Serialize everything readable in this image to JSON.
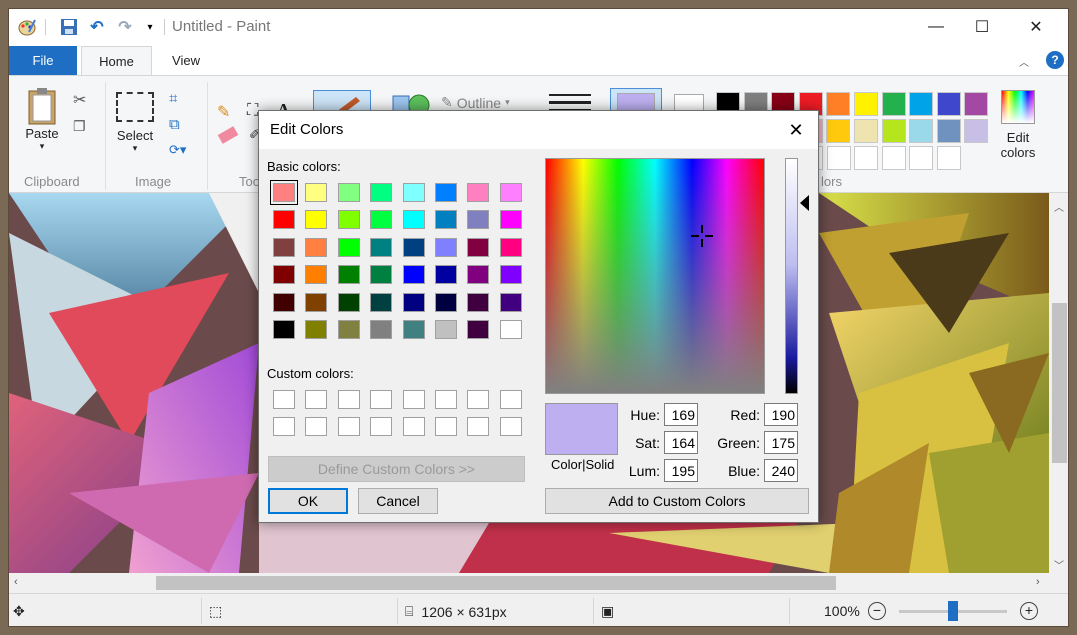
{
  "window": {
    "title": "Untitled - Paint",
    "controls": {
      "minimize": "—",
      "maximize": "☐",
      "close": "✕"
    }
  },
  "ribbon": {
    "tabs": [
      "File",
      "Home",
      "View"
    ],
    "clipboard": {
      "paste_label": "Paste",
      "group": "Clipboard"
    },
    "image": {
      "select_label": "Select",
      "group": "Image"
    },
    "tools": {
      "group": "Too"
    },
    "shapes": {
      "outline_label": "Outline"
    },
    "colors": {
      "group": "lors",
      "edit_colors_line1": "Edit",
      "edit_colors_line2": "colors"
    },
    "palette_row1": [
      "#000000",
      "#7f7f7f",
      "#880015",
      "#ed1c24",
      "#ff7f27",
      "#fff200",
      "#22b14c",
      "#00a2e8",
      "#3f48cc",
      "#a349a4"
    ],
    "palette_row2": [
      "#ffffff",
      "#c3c3c3",
      "#b97a57",
      "#ffaec9",
      "#ffc90e",
      "#efe4b0",
      "#b5e61d",
      "#99d9ea",
      "#7092be",
      "#c8bfe7"
    ],
    "color1": "#bdaff0",
    "color2": "#ffffff"
  },
  "dialog": {
    "title": "Edit Colors",
    "basic_colors_label": "Basic colors:",
    "custom_colors_label": "Custom colors:",
    "basic_colors": [
      [
        "#ff8080",
        "#ffff80",
        "#80ff80",
        "#00ff80",
        "#80ffff",
        "#0080ff",
        "#ff80c0",
        "#ff80ff"
      ],
      [
        "#ff0000",
        "#ffff00",
        "#80ff00",
        "#00ff40",
        "#00ffff",
        "#0080c0",
        "#8080c0",
        "#ff00ff"
      ],
      [
        "#804040",
        "#ff8040",
        "#00ff00",
        "#008080",
        "#004080",
        "#8080ff",
        "#800040",
        "#ff0080"
      ],
      [
        "#800000",
        "#ff8000",
        "#008000",
        "#008040",
        "#0000ff",
        "#0000a0",
        "#800080",
        "#8000ff"
      ],
      [
        "#400000",
        "#804000",
        "#004000",
        "#004040",
        "#000080",
        "#000040",
        "#400040",
        "#400080"
      ],
      [
        "#000000",
        "#808000",
        "#808040",
        "#808080",
        "#408080",
        "#c0c0c0",
        "#400040",
        "#ffffff"
      ]
    ],
    "define_custom_label": "Define Custom Colors >>",
    "ok_label": "OK",
    "cancel_label": "Cancel",
    "color_solid_label": "Color|Solid",
    "add_custom_label": "Add to Custom Colors",
    "fields": {
      "hue": {
        "label": "Hue:",
        "value": "169"
      },
      "sat": {
        "label": "Sat:",
        "value": "164"
      },
      "lum": {
        "label": "Lum:",
        "value": "195"
      },
      "red": {
        "label": "Red:",
        "value": "190"
      },
      "green": {
        "label": "Green:",
        "value": "175"
      },
      "blue": {
        "label": "Blue:",
        "value": "240"
      }
    },
    "preview_color": "#bdaff0"
  },
  "status": {
    "dimensions": "1206 × 631px",
    "zoom": "100%",
    "zoom_fraction": 0.5
  }
}
